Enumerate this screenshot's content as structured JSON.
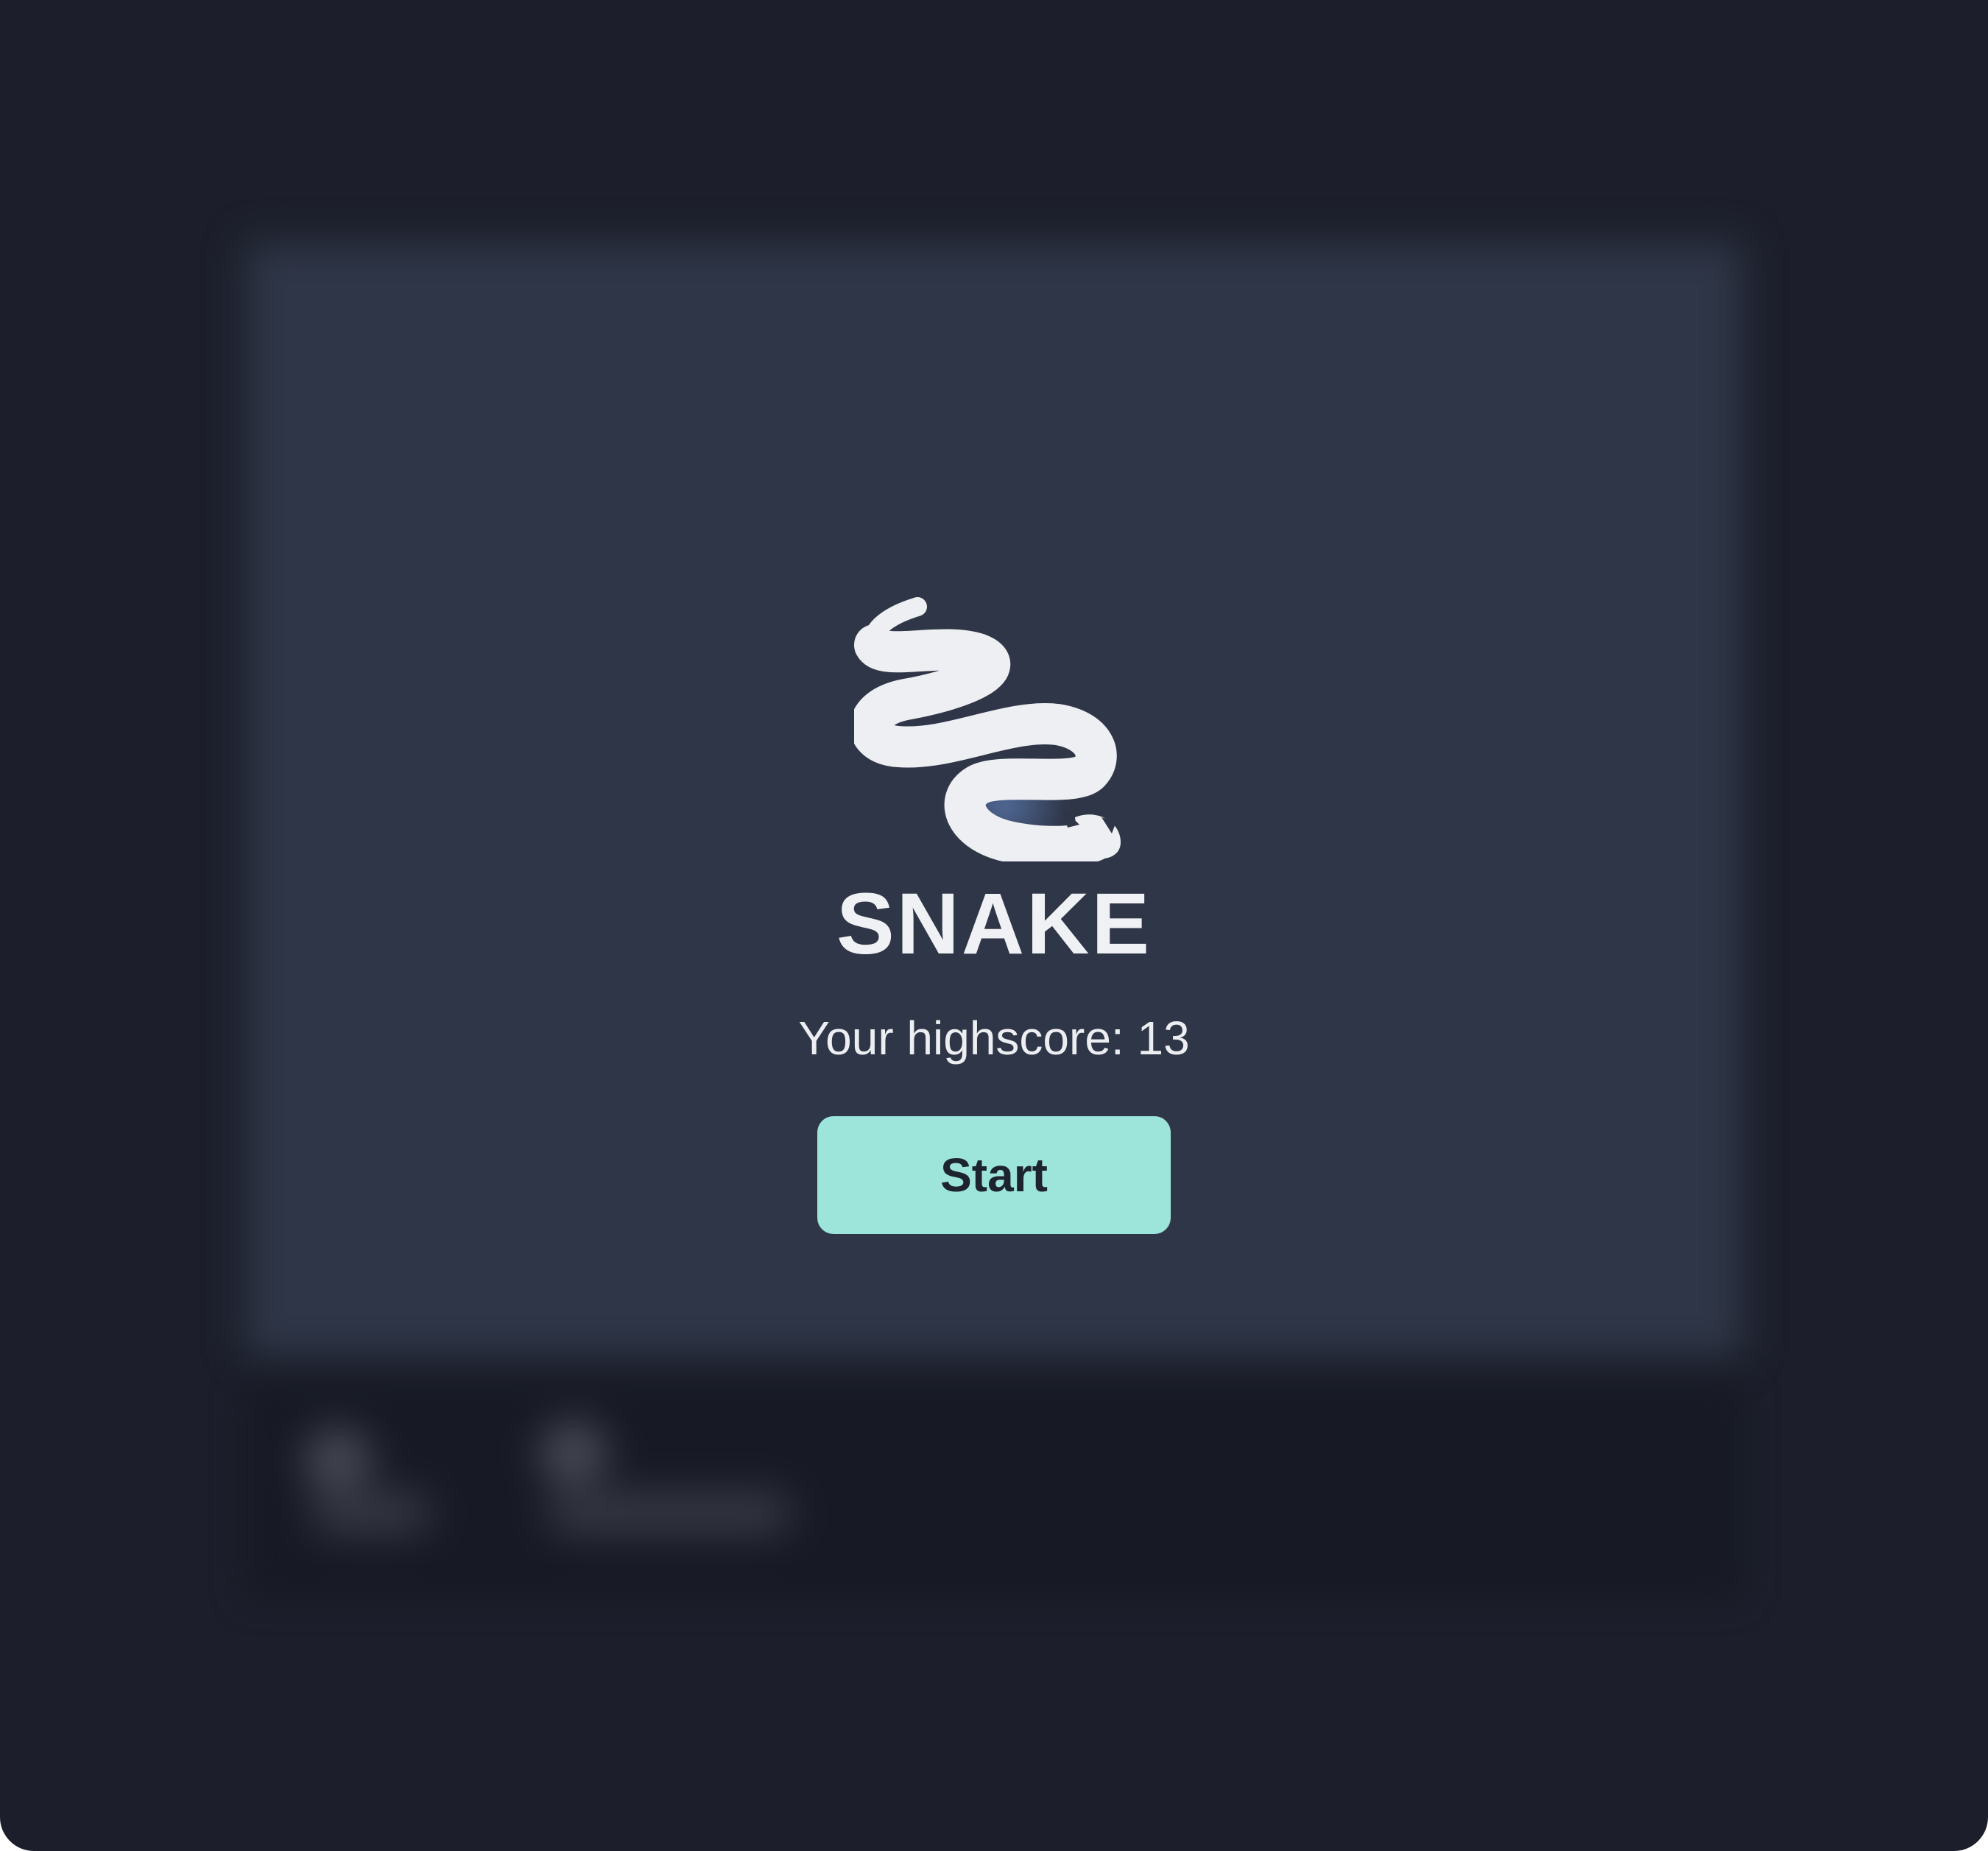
{
  "game": {
    "title": "SNAKE",
    "highscore_label": "Your highscore: 13",
    "highscore_value": 13,
    "start_label": "Start",
    "logo_icon": "snake-icon"
  },
  "colors": {
    "window_background": "#1c1f2b",
    "board_background": "#2f3647",
    "control_bar_background": "#171a24",
    "start_button": "#9de4da",
    "start_button_text": "#1d2430",
    "title_text": "#f0f1f4"
  }
}
